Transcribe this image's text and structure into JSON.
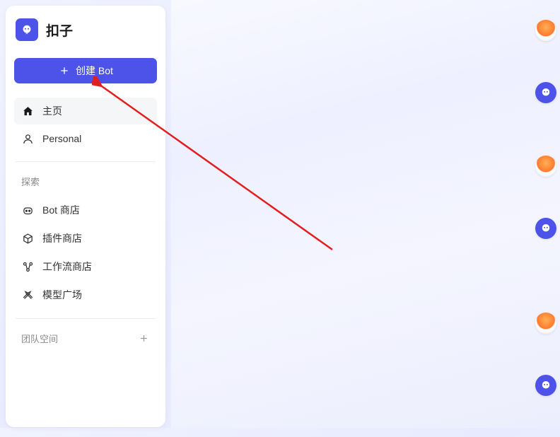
{
  "brand": {
    "name": "扣子"
  },
  "sidebar": {
    "create_label": "创建 Bot",
    "nav": {
      "home": "主页",
      "personal": "Personal"
    },
    "explore_label": "探索",
    "explore_items": {
      "bot_store": "Bot 商店",
      "plugin_store": "插件商店",
      "workflow_store": "工作流商店",
      "model_arena": "模型广场"
    },
    "team_label": "团队空间"
  },
  "colors": {
    "accent": "#4d53e8",
    "annotation": "#e02020"
  }
}
